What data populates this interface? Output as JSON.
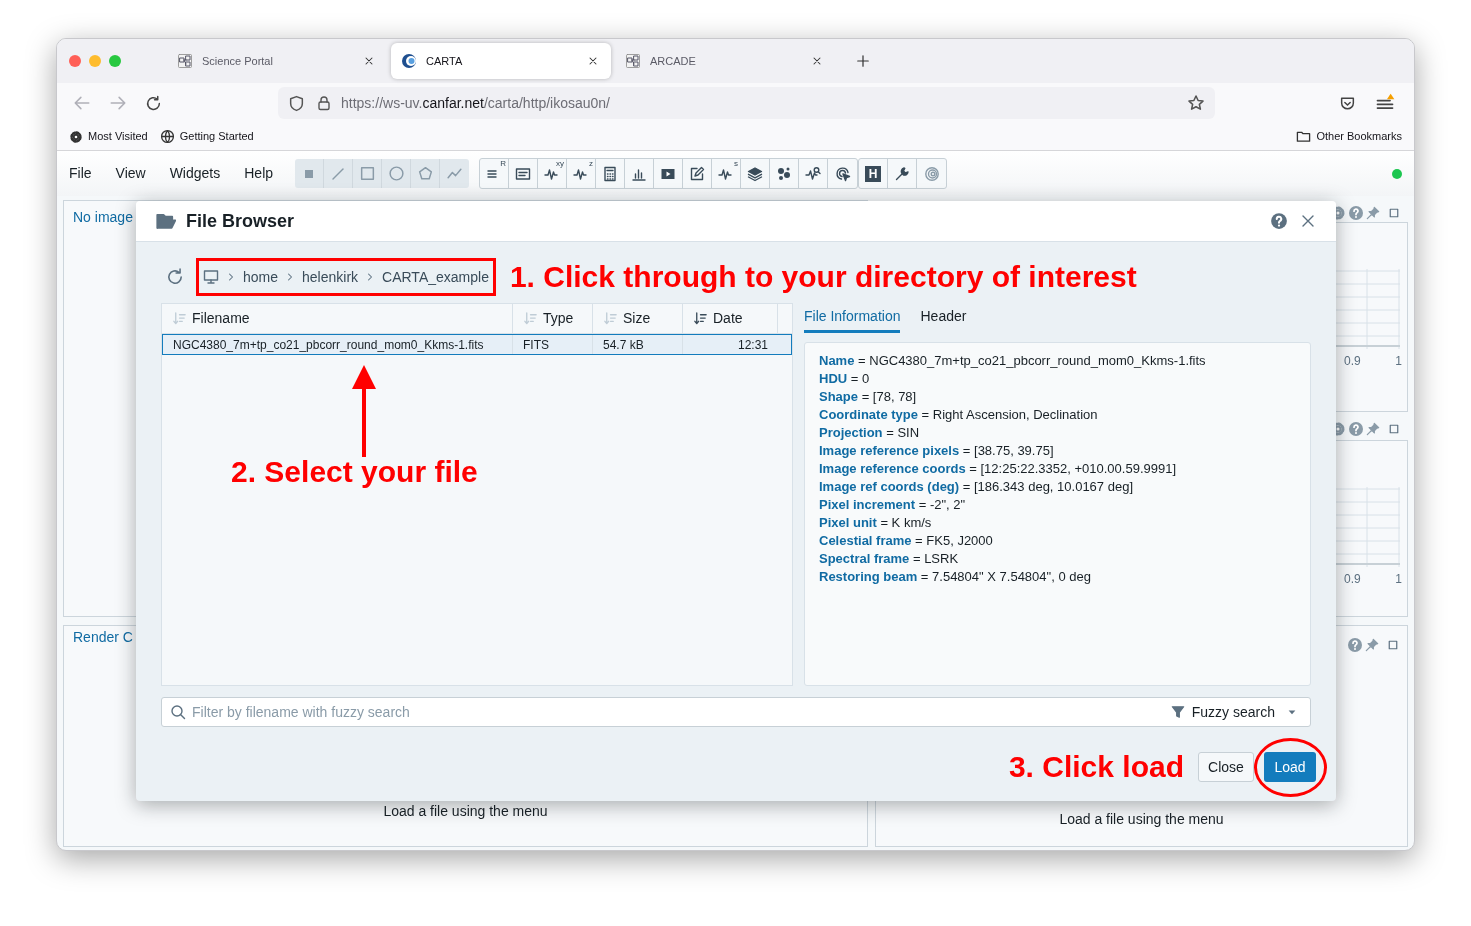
{
  "browser": {
    "tabs": [
      {
        "label": "Science Portal",
        "selected": false
      },
      {
        "label": "CARTA",
        "selected": true
      },
      {
        "label": "ARCADE",
        "selected": false
      }
    ],
    "url": {
      "scheme": "https://ws-uv.",
      "domain": "canfar.net",
      "path": "/carta/http/ikosau0n/"
    },
    "bookmarks": [
      "Most Visited",
      "Getting Started"
    ],
    "other_bookmarks": "Other Bookmarks"
  },
  "app": {
    "menu": [
      "File",
      "View",
      "Widgets",
      "Help"
    ],
    "toolbar_letters": [
      "R",
      "xy",
      "z",
      "s",
      "H"
    ]
  },
  "panels": {
    "image_view_title": "No image",
    "render_config_title": "Render C",
    "messages": [
      "Load a file using the menu",
      "Load a file using the menu"
    ],
    "charts": [
      {
        "tick_labels": [
          "0.9",
          "1"
        ]
      },
      {
        "tick_labels": [
          "0.9",
          "1"
        ]
      }
    ]
  },
  "file_browser": {
    "title": "File Browser",
    "breadcrumbs": [
      "home",
      "helenkirk",
      "CARTA_example"
    ],
    "columns": [
      {
        "label": "Filename",
        "sorted": false
      },
      {
        "label": "Type",
        "sorted": false
      },
      {
        "label": "Size",
        "sorted": false
      },
      {
        "label": "Date",
        "sorted": true
      }
    ],
    "rows": [
      {
        "cells": [
          "NGC4380_7m+tp_co21_pbcorr_round_mom0_Kkms-1.fits",
          "FITS",
          "54.7 kB",
          "12:31"
        ],
        "selected": true
      }
    ],
    "info_tabs": [
      {
        "label": "File Information",
        "selected": true
      },
      {
        "label": "Header",
        "selected": false
      }
    ],
    "info_lines": [
      "**Name** = NGC4380_7m+tp_co21_pbcorr_round_mom0_Kkms-1.fits",
      "**HDU** = 0",
      "**Shape** = [78, 78]",
      "**Coordinate type** = Right Ascension, Declination",
      "**Projection** = SIN",
      "**Image reference pixels** = [38.75, 39.75]",
      "**Image reference coords** = [12:25:22.3352, +010.00.59.9991]",
      "**Image ref coords (deg)** = [186.343 deg, 10.0167 deg]",
      "**Pixel increment** = -2\", 2\"",
      "**Pixel unit** = K km/s",
      "**Celestial frame** = FK5, J2000",
      "**Spectral frame** = LSRK",
      "**Restoring beam** = 7.54804\" X 7.54804\", 0 deg"
    ],
    "filter": {
      "placeholder": "Filter by filename with fuzzy search",
      "mode": "Fuzzy search"
    },
    "buttons": [
      {
        "label": "Close",
        "kind": "default"
      },
      {
        "label": "Load",
        "kind": "primary"
      }
    ]
  },
  "annotations": {
    "breadcrumbs": "1. Click through to your directory of interest",
    "file": "2. Select your file",
    "load": "3. Click load"
  }
}
